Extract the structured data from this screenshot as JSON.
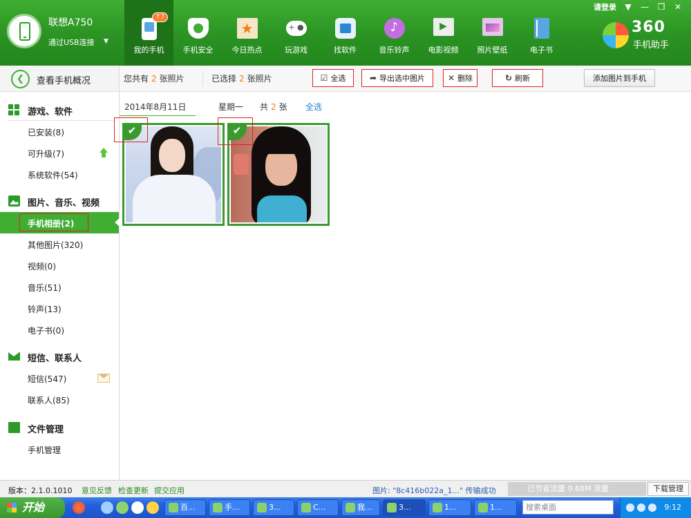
{
  "device": {
    "name": "联想A750",
    "connection": "通过USB连接"
  },
  "nav": [
    {
      "label": "我的手机",
      "badge": "↑7",
      "icon": "phone-icon"
    },
    {
      "label": "手机安全",
      "icon": "shield-icon"
    },
    {
      "label": "今日热点",
      "icon": "star-icon"
    },
    {
      "label": "玩游戏",
      "icon": "gamepad-icon"
    },
    {
      "label": "找软件",
      "icon": "software-bag-icon"
    },
    {
      "label": "音乐铃声",
      "icon": "music-icon"
    },
    {
      "label": "电影视频",
      "icon": "film-icon"
    },
    {
      "label": "照片壁纸",
      "icon": "picture-icon"
    },
    {
      "label": "电子书",
      "icon": "book-icon"
    }
  ],
  "window": {
    "login": "请登录",
    "controls": [
      "▼",
      "—",
      "❐",
      "✕"
    ]
  },
  "logo": {
    "text": "360",
    "subtitle": "手机助手"
  },
  "sidebar": {
    "overview": "查看手机概况",
    "groups": [
      {
        "title": "游戏、软件",
        "items": [
          "已安装(8)",
          "可升级(7)",
          "系统软件(54)"
        ]
      },
      {
        "title": "图片、音乐、视频",
        "items": [
          "手机相册(2)",
          "其他图片(320)",
          "视频(0)",
          "音乐(51)",
          "铃声(13)",
          "电子书(0)"
        ]
      },
      {
        "title": "短信、联系人",
        "items": [
          "短信(547)",
          "联系人(85)"
        ]
      },
      {
        "title": "文件管理",
        "items": [
          "手机管理"
        ]
      }
    ]
  },
  "toolbar": {
    "total_prefix": "您共有",
    "total_count": "2",
    "total_suffix": "张照片",
    "selected_prefix": "已选择",
    "selected_count": "2",
    "selected_suffix": "张照片",
    "select_all": "全选",
    "export": "导出选中图片",
    "delete": "删除",
    "refresh": "刷新",
    "add": "添加图片到手机"
  },
  "content": {
    "date": "2014年8月11日",
    "weekday": "星期一",
    "count_prefix": "共",
    "count": "2",
    "count_suffix": "张",
    "select_all_link": "全选",
    "photos": [
      {
        "selected": true
      },
      {
        "selected": true
      }
    ]
  },
  "statusbar": {
    "version": "版本：2.1.0.1010",
    "feedback": "意见反馈",
    "check_update": "检查更新",
    "submit_app": "提交应用",
    "transfer": "图片: \"8c416b022a_1...\" 传输成功",
    "saved": "已节省流量 0.68M 流量",
    "download_manager": "下载管理"
  },
  "taskbar": {
    "start": "开始",
    "tasks": [
      "百...",
      "手...",
      "3...",
      "C...",
      "我...",
      "3...",
      "1...",
      "1..."
    ],
    "search_placeholder": "搜索桌面",
    "clock": "9:12"
  }
}
